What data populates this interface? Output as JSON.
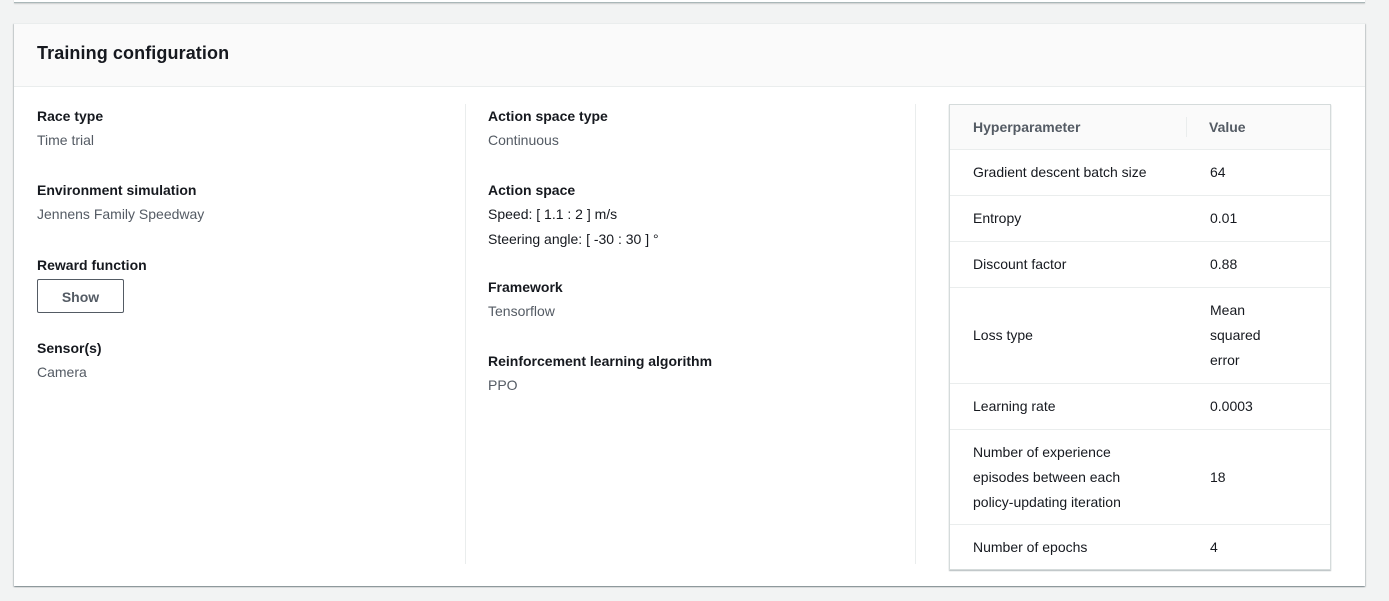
{
  "title": "Training configuration",
  "left": {
    "race_type_label": "Race type",
    "race_type_value": "Time trial",
    "env_label": "Environment simulation",
    "env_value": "Jennens Family Speedway",
    "reward_label": "Reward function",
    "reward_button": "Show",
    "sensor_label": "Sensor(s)",
    "sensor_value": "Camera"
  },
  "middle": {
    "action_space_type_label": "Action space type",
    "action_space_type_value": "Continuous",
    "action_space_label": "Action space",
    "speed_value": "Speed: [ 1.1 : 2 ] m/s",
    "steering_value": "Steering angle: [ -30 : 30 ] °",
    "framework_label": "Framework",
    "framework_value": "Tensorflow",
    "algo_label": "Reinforcement learning algorithm",
    "algo_value": "PPO"
  },
  "hyperparams": {
    "col_name": "Hyperparameter",
    "col_value": "Value",
    "rows": [
      {
        "name": "Gradient descent batch size",
        "value": "64"
      },
      {
        "name": "Entropy",
        "value": "0.01"
      },
      {
        "name": "Discount factor",
        "value": "0.88"
      },
      {
        "name": "Loss type",
        "value": "Mean squared error"
      },
      {
        "name": "Learning rate",
        "value": "0.0003"
      },
      {
        "name": "Number of experience episodes between each policy-updating iteration",
        "value": "18"
      },
      {
        "name": "Number of epochs",
        "value": "4"
      }
    ]
  }
}
